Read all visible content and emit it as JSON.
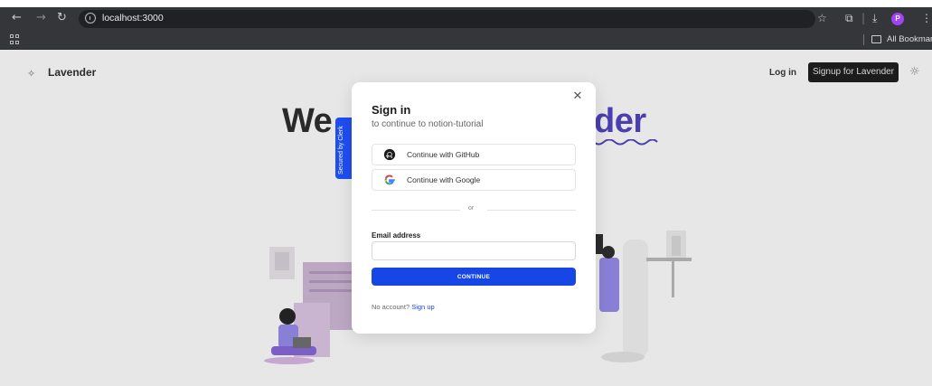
{
  "browser": {
    "url": "localhost:3000",
    "bookmarks_label": "All Bookmarks",
    "profile_initial": "P",
    "icons": [
      "back-icon",
      "forward-icon",
      "reload-icon",
      "site-info-icon",
      "star-icon",
      "extensions-icon",
      "download-icon",
      "menu-icon",
      "apps-icon",
      "folder-icon"
    ]
  },
  "navbar": {
    "brand": "Lavender",
    "login": "Log in",
    "signup": "Signup for Lavender"
  },
  "hero": {
    "left_text": "We",
    "right_text": "der"
  },
  "modal": {
    "secured_by": "Secured by Clerk",
    "title": "Sign in",
    "subtitle": "to continue to notion-tutorial",
    "github_label": "Continue with GitHub",
    "google_label": "Continue with Google",
    "divider": "or",
    "email_label": "Email address",
    "email_value": "",
    "continue_label": "CONTINUE",
    "no_account": "No account?",
    "signup_link": "Sign up"
  },
  "colors": {
    "primary": "#1646e6",
    "clerk_badge": "#1f4ef0",
    "brand_accent": "#4a3fb0",
    "page_bg": "#e7e7e7",
    "chrome_bg": "#35363a"
  }
}
